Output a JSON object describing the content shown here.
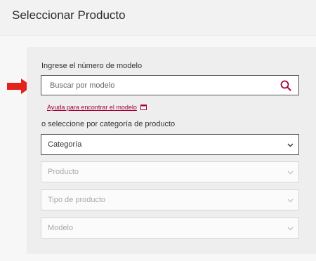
{
  "header": {
    "title": "Seleccionar Producto"
  },
  "model_search": {
    "label": "Ingrese el número de modelo",
    "placeholder": "Buscar por modelo",
    "help_link": "Ayuda para encontrar el modelo"
  },
  "category_section": {
    "label": "o seleccione por categoría de producto",
    "selects": [
      {
        "value": "Categoría",
        "enabled": true
      },
      {
        "value": "Producto",
        "enabled": false
      },
      {
        "value": "Tipo de producto",
        "enabled": false
      },
      {
        "value": "Modelo",
        "enabled": false
      }
    ]
  },
  "colors": {
    "accent": "#a50034",
    "arrow": "#e2231a",
    "panel_bg": "#eeeeee",
    "disabled_text": "#a8a8a8"
  },
  "icons": {
    "search": "search-icon",
    "help": "window-icon",
    "dropdown": "chevron-down-icon",
    "pointer": "arrow-right-icon"
  }
}
